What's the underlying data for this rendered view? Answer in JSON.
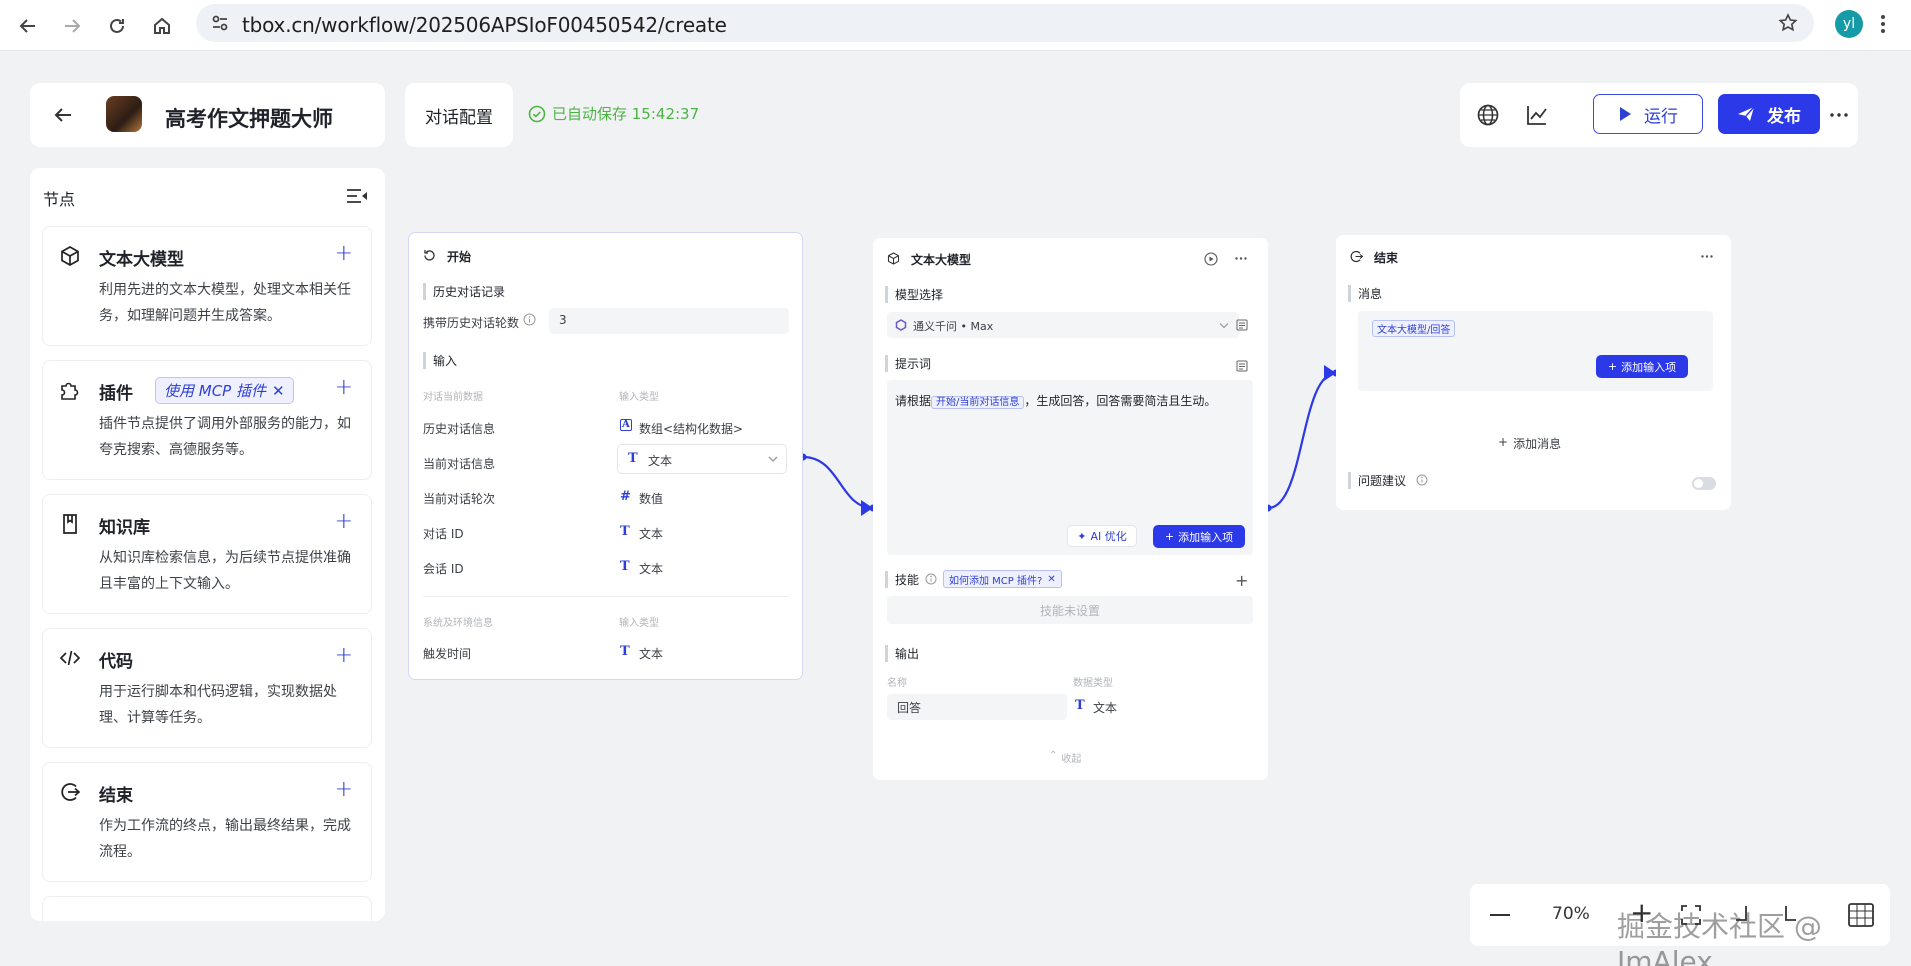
{
  "browser": {
    "url": "tbox.cn/workflow/202506APSIoF00450542/create",
    "profile_initials": "yl"
  },
  "header": {
    "title": "高考作文押题大师",
    "config_tab": "对话配置",
    "autosave": "已自动保存 15:42:37",
    "run_label": "运行",
    "publish_label": "发布"
  },
  "sidebar": {
    "title": "节点",
    "mcp_tag": "使用 MCP 插件",
    "items": [
      {
        "name": "文本大模型",
        "desc": "利用先进的文本大模型，处理文本相关任务，如理解问题并生成答案。"
      },
      {
        "name": "插件",
        "desc": "插件节点提供了调用外部服务的能力，如夸克搜索、高德服务等。"
      },
      {
        "name": "知识库",
        "desc": "从知识库检索信息，为后续节点提供准确且丰富的上下文输入。"
      },
      {
        "name": "代码",
        "desc": "用于运行脚本和代码逻辑，实现数据处理、计算等任务。"
      },
      {
        "name": "结束",
        "desc": "作为工作流的终点，输出最终结果，完成流程。"
      }
    ]
  },
  "start_node": {
    "title": "开始",
    "history_section": "历史对话记录",
    "history_rounds_label": "携带历史对话轮数",
    "history_rounds_value": "3",
    "input_section": "输入",
    "col_var": "对话当前数据",
    "col_type": "输入类型",
    "rows": [
      {
        "name": "历史对话信息",
        "type": "数组<结构化数据>"
      },
      {
        "name": "当前对话信息",
        "type": "文本"
      },
      {
        "name": "当前对话轮次",
        "type": "数值"
      },
      {
        "name": "对话 ID",
        "type": "文本"
      },
      {
        "name": "会话 ID",
        "type": "文本"
      }
    ],
    "sys_col_var": "系统及环境信息",
    "sys_col_type": "输入类型",
    "sys_rows": [
      {
        "name": "触发时间",
        "type": "文本"
      }
    ]
  },
  "llm_node": {
    "title": "文本大模型",
    "model_section": "模型选择",
    "model_value": "通义千问 • Max",
    "prompt_section": "提示词",
    "prompt_prefix": "请根据",
    "prompt_chip": "开始/当前对话信息",
    "prompt_suffix": "，生成回答，回答需要简洁且生动。",
    "ai_optimize": "AI 优化",
    "add_input": "添加输入项",
    "skills_section": "技能",
    "skill_tag": "如何添加 MCP 插件?",
    "skills_empty": "技能未设置",
    "output_section": "输出",
    "out_col_name": "名称",
    "out_col_type": "数据类型",
    "out_name": "回答",
    "out_type": "文本",
    "collapse": "收起"
  },
  "end_node": {
    "title": "结束",
    "message_section": "消息",
    "message_chip": "文本大模型/回答",
    "add_input": "添加输入项",
    "add_message": "添加消息",
    "suggest_label": "问题建议"
  },
  "zoom": {
    "level": "70%"
  },
  "watermark": "掘金技术社区 @ ImAlex",
  "colors": {
    "accent": "#2b39e8",
    "success": "#4bb543",
    "edge": "#2b39e8"
  }
}
